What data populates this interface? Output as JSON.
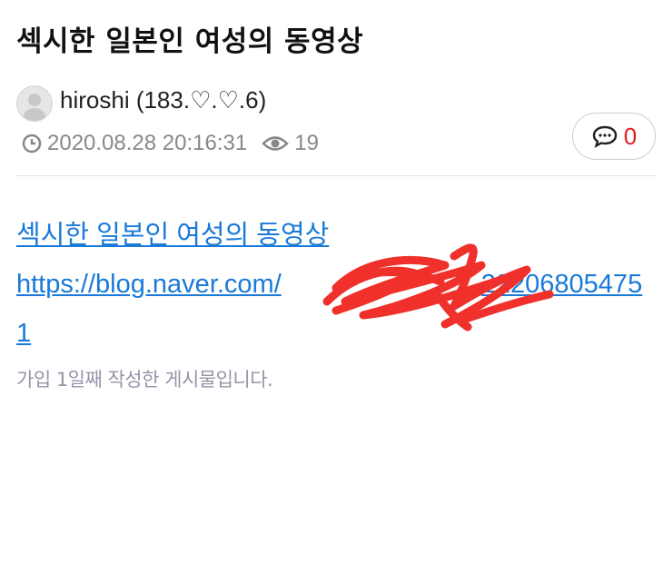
{
  "post": {
    "title": "섹시한 일본인 여성의 동영상",
    "author": "hiroshi (183.♡.♡.6)",
    "date": "2020.08.28 20:16:31",
    "views": "19",
    "comment_count": "0",
    "body_line1": "섹시한 일본인 여성의 동영상",
    "body_link": "https://blog.naver.com/ ... 22206805475 1",
    "body_link_line1": "https://blog.naver.com/",
    "body_link_tail": "22206805475",
    "body_link_line2": "1",
    "note": "가입 1일째 작성한 게시물입니다."
  },
  "icons": {
    "avatar": "user-avatar-icon",
    "clock": "clock-icon",
    "views": "eye-icon",
    "comments": "speech-bubble-icon"
  },
  "colors": {
    "link": "#1a7ad8",
    "comment_count": "#e02020",
    "meta": "#888888",
    "note": "#9a92a8",
    "redaction": "#f0302a"
  }
}
